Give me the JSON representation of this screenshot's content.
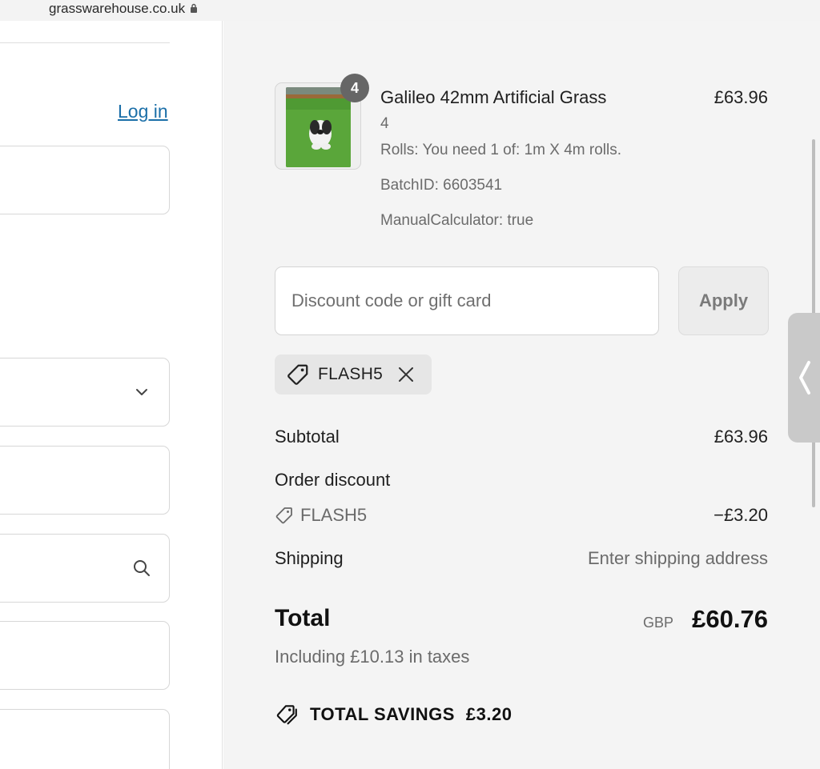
{
  "browser": {
    "url": "grasswarehouse.co.uk"
  },
  "left": {
    "login_label": "Log in"
  },
  "order_summary": {
    "item": {
      "title": "Galileo 42mm Artificial Grass",
      "price": "£63.96",
      "quantity_badge": "4",
      "quantity": "4",
      "rolls": "Rolls: You need 1 of: 1m X 4m rolls.",
      "batch_id": "BatchID: 6603541",
      "manual_calculator": "ManualCalculator: true"
    },
    "discount": {
      "placeholder": "Discount code or gift card",
      "apply_label": "Apply",
      "applied_code": "FLASH5"
    },
    "lines": {
      "subtotal_label": "Subtotal",
      "subtotal_value": "£63.96",
      "order_discount_label": "Order discount",
      "discount_code": "FLASH5",
      "discount_value": "−£3.20",
      "shipping_label": "Shipping",
      "shipping_value": "Enter shipping address"
    },
    "total": {
      "label": "Total",
      "currency": "GBP",
      "amount": "£60.76",
      "tax_note": "Including £10.13 in taxes"
    },
    "savings": {
      "label": "TOTAL SAVINGS",
      "amount": "£3.20"
    }
  },
  "icons": {
    "lock": "lock-icon",
    "chevron": "chevron-down-icon",
    "search": "search-icon",
    "tag": "tag-icon",
    "close": "close-icon",
    "savings": "tags-icon",
    "side_tab": "chevron-left-icon"
  },
  "colors": {
    "link": "#1b6fa8",
    "summary_bg": "#f4f4f4",
    "badge": "#666666"
  }
}
